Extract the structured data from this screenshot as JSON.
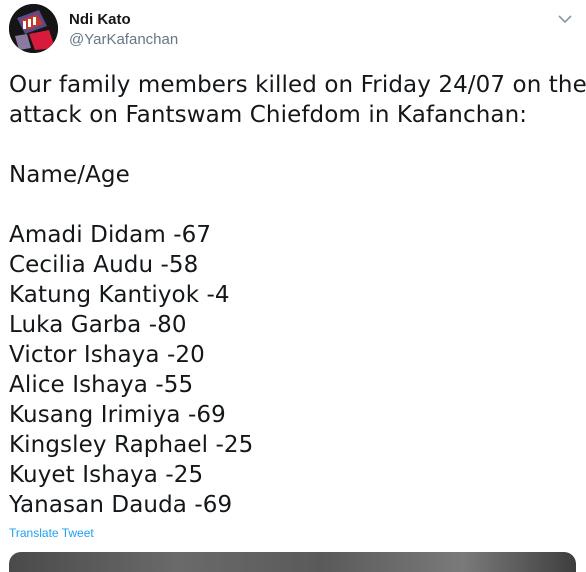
{
  "author": {
    "display_name": "Ndi Kato",
    "handle": "@YarKafanchan"
  },
  "tweet": {
    "intro_line_1": "Our family members killed on Friday 24/07 on the",
    "intro_line_2": "attack on Fantswam Chiefdom in Kafanchan:",
    "list_header": "Name/Age",
    "victims": [
      "Amadi Didam -67",
      "Cecilia Audu -58",
      "Katung Kantiyok -4",
      "Luka Garba -80",
      "Victor Ishaya -20",
      "Alice Ishaya -55",
      "Kusang Irimiya -69",
      "Kingsley Raphael -25",
      "Kuyet Ishaya -25",
      "Yanasan Dauda -69"
    ]
  },
  "actions": {
    "translate_label": "Translate Tweet"
  },
  "icons": {
    "more": "chevron-down-icon",
    "avatar": "avatar"
  },
  "colors": {
    "link": "#1da1f2",
    "secondary_text": "#657786",
    "primary_text": "#14171a"
  }
}
